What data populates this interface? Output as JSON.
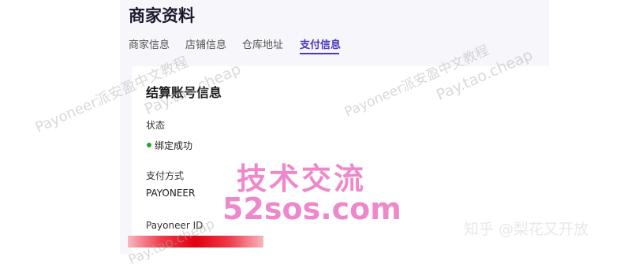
{
  "page": {
    "title": "商家资料"
  },
  "tabs": [
    {
      "label": "商家信息",
      "active": false
    },
    {
      "label": "店铺信息",
      "active": false
    },
    {
      "label": "仓库地址",
      "active": false
    },
    {
      "label": "支付信息",
      "active": true
    }
  ],
  "section": {
    "title": "结算账号信息",
    "fields": [
      {
        "label": "状态",
        "value": "绑定成功"
      },
      {
        "label": "支付方式",
        "value": "PAYONEER"
      },
      {
        "label": "Payoneer ID",
        "value": ""
      }
    ]
  },
  "watermarks": {
    "text_cn": "Payoneer派安盈中文教程",
    "text_url": "Pay.tao.cheap"
  },
  "overlay": {
    "line1": "技术交流",
    "line2": "52sos.com"
  },
  "credit": "知乎 @梨花又开放",
  "colors": {
    "accent": "#4a3ab8",
    "status_success": "#2aa52a",
    "overlay_pink": "#ee88cc"
  }
}
